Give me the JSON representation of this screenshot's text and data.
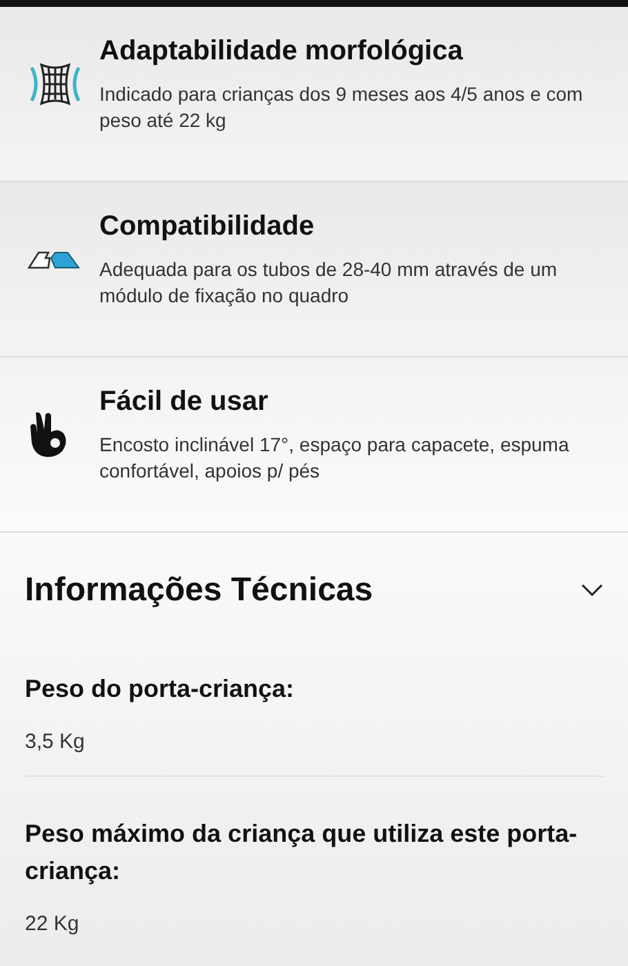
{
  "features": [
    {
      "kind": "body",
      "title": "Adaptabilidade morfológica",
      "description": "Indicado para crianças dos 9 meses aos 4/5 anos e com peso até 22 kg"
    },
    {
      "kind": "tubes",
      "title": "Compatibilidade",
      "description": "Adequada para os tubos de 28-40 mm através de um módulo de fixação no quadro"
    },
    {
      "kind": "hand",
      "title": "Fácil de usar",
      "description": "Encosto inclinável 17°, espaço para capacete, espuma confortável, apoios p/ pés"
    }
  ],
  "technical_info": {
    "title": "Informações Técnicas",
    "expanded": true,
    "specs": [
      {
        "label": "Peso do porta-criança:",
        "value": "3,5 Kg"
      },
      {
        "label": "Peso máximo da criança que utiliza este porta-criança:",
        "value": "22 Kg"
      }
    ]
  }
}
